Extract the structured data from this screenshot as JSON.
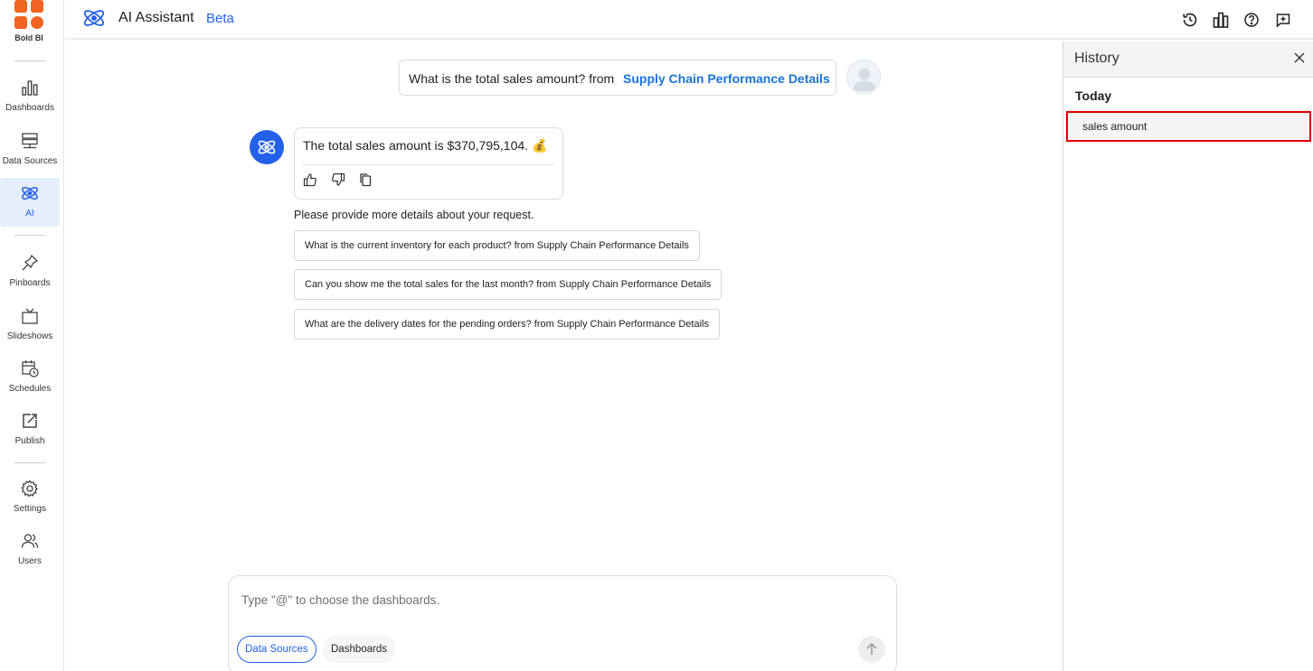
{
  "brand": {
    "logo_text": "Bold BI",
    "brand_color": "#f26422",
    "accent": "#2361e8"
  },
  "nav": {
    "items": [
      {
        "label": "Dashboards",
        "icon": "bar-chart-icon"
      },
      {
        "label": "Data Sources",
        "icon": "server-icon"
      },
      {
        "label": "AI",
        "icon": "atom-icon",
        "active": true
      },
      {
        "label": "Pinboards",
        "icon": "pin-icon"
      },
      {
        "label": "Slideshows",
        "icon": "tv-icon"
      },
      {
        "label": "Schedules",
        "icon": "calendar-clock-icon"
      },
      {
        "label": "Publish",
        "icon": "share-icon"
      },
      {
        "label": "Settings",
        "icon": "gear-icon"
      },
      {
        "label": "Users",
        "icon": "users-icon"
      }
    ]
  },
  "topbar": {
    "title": "AI Assistant",
    "badge": "Beta",
    "icons": [
      "history-icon",
      "dashboard-bar-icon",
      "help-icon",
      "feedback-icon"
    ]
  },
  "chat": {
    "user_question": "What is the total sales amount? from",
    "user_source": "Supply Chain Performance Details",
    "bot_answer": "The total sales amount is $370,795,104. 💰",
    "feedback_icons": [
      "thumbs-up-icon",
      "thumbs-down-icon",
      "copy-icon"
    ],
    "prompt_hint": "Please provide more details about your request.",
    "suggestions": [
      "What is the current inventory for each product? from Supply Chain Performance Details",
      "Can you show me the total sales for the last month? from Supply Chain Performance Details",
      "What are the delivery dates for the pending orders? from Supply Chain Performance Details"
    ]
  },
  "composer": {
    "placeholder": "Type \"@\" to choose the dashboards.",
    "chip_data_sources": "Data Sources",
    "chip_dashboards": "Dashboards"
  },
  "history": {
    "title": "History",
    "group": "Today",
    "items": [
      "sales amount"
    ]
  }
}
